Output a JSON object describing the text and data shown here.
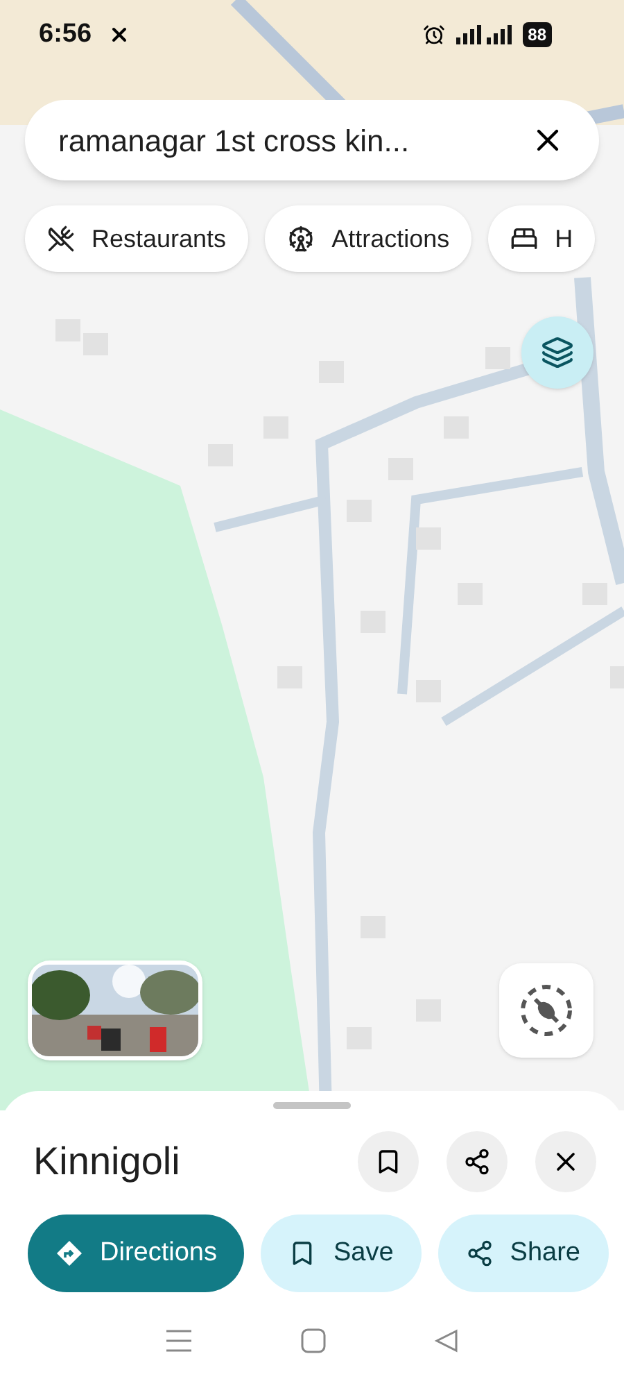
{
  "status_bar": {
    "time": "6:56",
    "battery": "88"
  },
  "search": {
    "value": "ramanagar 1st cross kin..."
  },
  "chips": [
    {
      "kind": "restaurant",
      "label": "Restaurants"
    },
    {
      "kind": "attraction",
      "label": "Attractions"
    },
    {
      "kind": "hotel",
      "label": "H"
    }
  ],
  "place": {
    "title": "Kinnigoli"
  },
  "actions": [
    {
      "kind": "directions",
      "label": "Directions"
    },
    {
      "kind": "save",
      "label": "Save"
    },
    {
      "kind": "share",
      "label": "Share"
    }
  ]
}
